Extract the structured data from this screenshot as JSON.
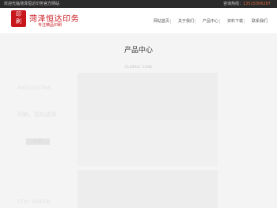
{
  "topbar": {
    "welcome": "欢迎光临菏泽恒达印务官方网站",
    "hotline_label": "咨询热线：",
    "hotline_number": "13515306287"
  },
  "logo": {
    "seal_chars": [
      "印",
      "刷"
    ],
    "name": "菏泽恒达印务",
    "slogan": "专注精品印刷"
  },
  "nav": [
    {
      "label": "网站首页"
    },
    {
      "label": "关于我们"
    },
    {
      "label": "产品中心"
    },
    {
      "label": "资料下载"
    },
    {
      "label": "联系我们"
    }
  ],
  "section": {
    "title": "产品中心",
    "subtitle": "CLASSIC CASE"
  },
  "ghost": {
    "en_1": "ANQUOSTAR",
    "cn_1": "印刷，您的选择",
    "more": "MORE",
    "en_2": "STAY BASEN"
  },
  "colors": {
    "brand_red": "#c8161d",
    "topbar_bg": "#2b2b2b",
    "hotline_accent": "#e06a3a"
  }
}
